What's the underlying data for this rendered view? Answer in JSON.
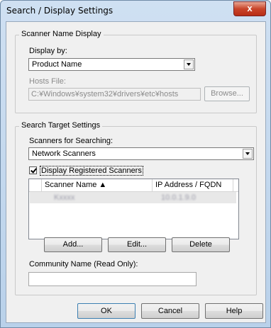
{
  "window": {
    "title": "Search / Display Settings",
    "close_label": "x"
  },
  "scanner_name_display": {
    "group_title": "Scanner Name Display",
    "display_by_label": "Display by:",
    "display_by_value": "Product Name",
    "hosts_file_label": "Hosts File:",
    "hosts_file_value": "C:¥Windows¥system32¥drivers¥etc¥hosts",
    "browse_label": "Browse..."
  },
  "search_target": {
    "group_title": "Search Target Settings",
    "scanners_label": "Scanners for Searching:",
    "scanners_value": "Network Scanners",
    "display_registered_label": "Display Registered Scanners",
    "display_registered_checked": true,
    "table": {
      "columns": [
        "Scanner Name ▲",
        "IP Address / FQDN"
      ],
      "rows": [
        {
          "name": "Kxxxx",
          "address": "10.0.1.9.0"
        }
      ]
    },
    "add_label": "Add...",
    "edit_label": "Edit...",
    "delete_label": "Delete",
    "community_label": "Community Name (Read Only):",
    "community_value": ""
  },
  "footer": {
    "ok_label": "OK",
    "cancel_label": "Cancel",
    "help_label": "Help"
  },
  "colors": {
    "titlebar": "#b9d1ea",
    "close_button": "#c9452a",
    "dialog_bg": "#f0f0f0"
  }
}
